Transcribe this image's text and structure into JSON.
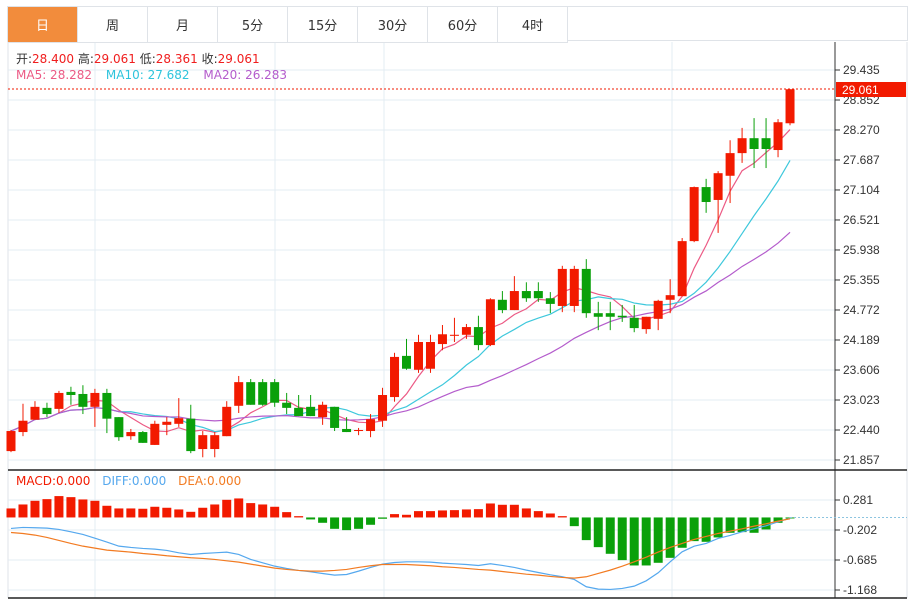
{
  "tabs": [
    {
      "label": "日",
      "active": true
    },
    {
      "label": "周"
    },
    {
      "label": "月"
    },
    {
      "label": "5分"
    },
    {
      "label": "15分"
    },
    {
      "label": "30分"
    },
    {
      "label": "60分"
    },
    {
      "label": "4时"
    }
  ],
  "ohlc_info": {
    "open_label": "开:",
    "open": "28.400",
    "high_label": "高:",
    "high": "29.061",
    "low_label": "低:",
    "low": "28.361",
    "close_label": "收:",
    "close": "29.061"
  },
  "ma_info": {
    "ma5": "MA5: 28.282",
    "ma10": "MA10: 27.682",
    "ma20": "MA20: 26.283"
  },
  "macd_info": {
    "macd": "MACD:0.000",
    "diff": "DIFF:0.000",
    "dea": "DEA:0.000"
  },
  "current_price_label": "29.061",
  "colors": {
    "accent_tab": "#f28c3c",
    "up": "#f21a00",
    "down": "#0aa00a",
    "ma5": "#ec5a85",
    "ma10": "#3ec8dc",
    "ma20": "#b45ccc",
    "diff": "#55a8ee",
    "dea": "#f27b22"
  },
  "chart_data": [
    {
      "type": "candlestick",
      "y_ticks": [
        "29.435",
        "28.852",
        "28.270",
        "27.687",
        "27.104",
        "26.521",
        "25.938",
        "25.355",
        "24.772",
        "24.189",
        "23.606",
        "23.023",
        "22.440",
        "21.857"
      ],
      "ylim": [
        21.857,
        29.435
      ],
      "ma_periods": [
        5,
        10,
        20
      ],
      "candles": [
        [
          22.03,
          22.44,
          22.01,
          22.42
        ],
        [
          22.4,
          22.95,
          22.32,
          22.62
        ],
        [
          22.64,
          23.0,
          22.64,
          22.89
        ],
        [
          22.87,
          22.97,
          22.69,
          22.75
        ],
        [
          22.85,
          23.2,
          22.77,
          23.16
        ],
        [
          23.18,
          23.28,
          22.93,
          23.12
        ],
        [
          23.14,
          23.31,
          22.75,
          22.89
        ],
        [
          22.89,
          23.24,
          22.5,
          23.16
        ],
        [
          23.16,
          23.24,
          22.38,
          22.66
        ],
        [
          22.69,
          22.69,
          22.23,
          22.3
        ],
        [
          22.32,
          22.46,
          22.25,
          22.4
        ],
        [
          22.4,
          22.42,
          22.19,
          22.19
        ],
        [
          22.15,
          22.62,
          22.15,
          22.56
        ],
        [
          22.54,
          22.69,
          22.34,
          22.6
        ],
        [
          22.56,
          23.06,
          22.5,
          22.67
        ],
        [
          22.66,
          22.93,
          21.99,
          22.03
        ],
        [
          22.07,
          22.42,
          21.91,
          22.34
        ],
        [
          22.07,
          22.4,
          21.91,
          22.34
        ],
        [
          22.32,
          23.0,
          22.32,
          22.89
        ],
        [
          22.91,
          23.49,
          22.77,
          23.37
        ],
        [
          23.37,
          23.43,
          22.93,
          22.93
        ],
        [
          23.37,
          23.43,
          22.91,
          22.93
        ],
        [
          23.37,
          23.43,
          22.89,
          22.97
        ],
        [
          22.97,
          23.16,
          22.75,
          22.87
        ],
        [
          22.87,
          23.12,
          22.71,
          22.71
        ],
        [
          22.89,
          23.12,
          22.71,
          22.71
        ],
        [
          22.69,
          22.99,
          22.54,
          22.93
        ],
        [
          22.89,
          22.89,
          22.42,
          22.48
        ],
        [
          22.46,
          22.69,
          22.4,
          22.4
        ],
        [
          22.42,
          22.48,
          22.34,
          22.44
        ],
        [
          22.42,
          22.75,
          22.3,
          22.65
        ],
        [
          22.62,
          23.26,
          22.5,
          23.12
        ],
        [
          23.08,
          23.94,
          22.99,
          23.86
        ],
        [
          23.88,
          24.21,
          23.61,
          23.63
        ],
        [
          23.61,
          24.29,
          23.55,
          24.15
        ],
        [
          23.63,
          24.29,
          23.55,
          24.15
        ],
        [
          24.11,
          24.48,
          23.99,
          24.3
        ],
        [
          24.27,
          24.62,
          24.15,
          24.29
        ],
        [
          24.29,
          24.5,
          24.21,
          24.44
        ],
        [
          24.44,
          24.66,
          23.99,
          24.09
        ],
        [
          24.09,
          25.0,
          24.07,
          24.98
        ],
        [
          24.97,
          25.14,
          24.71,
          24.77
        ],
        [
          24.77,
          25.43,
          24.77,
          25.14
        ],
        [
          25.14,
          25.31,
          24.93,
          25.0
        ],
        [
          25.14,
          25.31,
          24.93,
          25.0
        ],
        [
          25.0,
          25.12,
          24.71,
          24.89
        ],
        [
          24.85,
          25.63,
          24.73,
          25.57
        ],
        [
          24.85,
          25.63,
          24.73,
          25.57
        ],
        [
          25.57,
          25.76,
          24.62,
          24.71
        ],
        [
          24.71,
          24.93,
          24.38,
          24.64
        ],
        [
          24.71,
          24.93,
          24.38,
          24.64
        ],
        [
          24.66,
          24.87,
          24.54,
          24.63
        ],
        [
          24.62,
          24.87,
          24.34,
          24.42
        ],
        [
          24.4,
          24.64,
          24.31,
          24.64
        ],
        [
          24.6,
          24.97,
          24.38,
          24.95
        ],
        [
          24.97,
          25.37,
          24.71,
          25.06
        ],
        [
          25.04,
          26.17,
          25.04,
          26.11
        ],
        [
          26.11,
          27.17,
          26.09,
          27.16
        ],
        [
          27.16,
          27.32,
          26.66,
          26.87
        ],
        [
          26.91,
          27.47,
          26.27,
          27.43
        ],
        [
          27.38,
          28.07,
          26.85,
          27.82
        ],
        [
          27.82,
          28.31,
          27.63,
          28.11
        ],
        [
          28.11,
          28.5,
          27.53,
          27.9
        ],
        [
          28.11,
          28.5,
          27.53,
          27.9
        ],
        [
          27.88,
          28.48,
          27.74,
          28.42
        ],
        [
          28.4,
          29.061,
          28.361,
          29.061
        ]
      ],
      "candle_format": [
        "open",
        "high",
        "low",
        "close"
      ]
    },
    {
      "type": "macd",
      "y_ticks": [
        "0.281",
        "-0.202",
        "-0.685",
        "-1.168"
      ],
      "ylim": [
        -1.168,
        0.281
      ],
      "macd": [
        0.145,
        0.209,
        0.268,
        0.295,
        0.344,
        0.327,
        0.29,
        0.268,
        0.188,
        0.145,
        0.145,
        0.14,
        0.172,
        0.156,
        0.129,
        0.091,
        0.156,
        0.209,
        0.284,
        0.306,
        0.231,
        0.209,
        0.172,
        0.086,
        0.021,
        -0.032,
        -0.086,
        -0.183,
        -0.204,
        -0.183,
        -0.118,
        -0.021,
        0.054,
        0.043,
        0.102,
        0.102,
        0.113,
        0.118,
        0.129,
        0.134,
        0.225,
        0.204,
        0.204,
        0.145,
        0.102,
        0.064,
        0.021,
        -0.14,
        -0.365,
        -0.478,
        -0.585,
        -0.687,
        -0.773,
        -0.773,
        -0.73,
        -0.65,
        -0.488,
        -0.381,
        -0.392,
        -0.322,
        -0.247,
        -0.236,
        -0.247,
        -0.193,
        -0.086,
        -0.016
      ],
      "diff": [
        -0.177,
        -0.161,
        -0.166,
        -0.172,
        -0.193,
        -0.231,
        -0.274,
        -0.333,
        -0.397,
        -0.462,
        -0.483,
        -0.499,
        -0.51,
        -0.531,
        -0.569,
        -0.596,
        -0.58,
        -0.569,
        -0.558,
        -0.596,
        -0.676,
        -0.73,
        -0.784,
        -0.821,
        -0.853,
        -0.875,
        -0.902,
        -0.929,
        -0.918,
        -0.864,
        -0.805,
        -0.751,
        -0.725,
        -0.714,
        -0.714,
        -0.719,
        -0.735,
        -0.746,
        -0.757,
        -0.773,
        -0.746,
        -0.773,
        -0.805,
        -0.848,
        -0.886,
        -0.923,
        -0.955,
        -0.998,
        -1.116,
        -1.154,
        -1.159,
        -1.143,
        -1.106,
        -1.02,
        -0.891,
        -0.714,
        -0.553,
        -0.462,
        -0.419,
        -0.338,
        -0.29,
        -0.231,
        -0.183,
        -0.134,
        -0.07,
        -0.011
      ],
      "dea": [
        -0.242,
        -0.258,
        -0.284,
        -0.322,
        -0.37,
        -0.419,
        -0.462,
        -0.494,
        -0.526,
        -0.542,
        -0.558,
        -0.58,
        -0.596,
        -0.617,
        -0.633,
        -0.649,
        -0.66,
        -0.676,
        -0.698,
        -0.719,
        -0.751,
        -0.784,
        -0.816,
        -0.837,
        -0.853,
        -0.864,
        -0.864,
        -0.853,
        -0.837,
        -0.805,
        -0.778,
        -0.757,
        -0.757,
        -0.757,
        -0.768,
        -0.778,
        -0.794,
        -0.805,
        -0.821,
        -0.837,
        -0.848,
        -0.87,
        -0.891,
        -0.913,
        -0.929,
        -0.95,
        -0.966,
        -0.977,
        -0.955,
        -0.902,
        -0.848,
        -0.784,
        -0.714,
        -0.639,
        -0.558,
        -0.483,
        -0.419,
        -0.354,
        -0.306,
        -0.258,
        -0.22,
        -0.183,
        -0.14,
        -0.102,
        -0.059,
        -0.021
      ]
    }
  ]
}
